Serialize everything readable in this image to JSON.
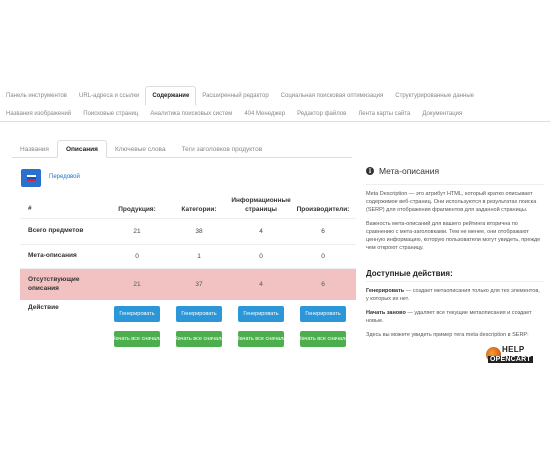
{
  "top_tabs": {
    "row1": [
      {
        "label": "Панель инструментов",
        "active": false
      },
      {
        "label": "URL-адреса и ссылки",
        "active": false
      },
      {
        "label": "Содержание",
        "active": true
      },
      {
        "label": "Расширенный редактор",
        "active": false
      },
      {
        "label": "Социальная поисковая оптимизация",
        "active": false
      },
      {
        "label": "Структурированные данные",
        "active": false
      }
    ],
    "row2": [
      {
        "label": "Названия изображений",
        "active": false
      },
      {
        "label": "Поисковые страниц",
        "active": false
      },
      {
        "label": "Аналитика поисковых систем",
        "active": false
      },
      {
        "label": "404 Менеджер",
        "active": false
      },
      {
        "label": "Редактор файлов",
        "active": false
      },
      {
        "label": "Лента карты сайта",
        "active": false
      },
      {
        "label": "Документация",
        "active": false
      }
    ]
  },
  "sub_tabs": [
    {
      "label": "Названия",
      "active": false
    },
    {
      "label": "Описания",
      "active": true
    },
    {
      "label": "Ключевые слова",
      "active": false
    },
    {
      "label": "Теги заголовков продуктов",
      "active": false
    }
  ],
  "advanced_link": "Передовой",
  "table": {
    "headers": [
      "#",
      "Продукция:",
      "Категории:",
      "Информационные страницы",
      "Производители:"
    ],
    "rows": [
      {
        "label": "Всего предметов",
        "values": [
          "21",
          "38",
          "4",
          "6"
        ]
      },
      {
        "label": "Мета-описания",
        "values": [
          "0",
          "1",
          "0",
          "0"
        ]
      },
      {
        "label": "Отсутствующие описания",
        "values": [
          "21",
          "37",
          "4",
          "6"
        ]
      }
    ],
    "action_label": "Действие",
    "generate_label": "Генерировать",
    "reset_label": "Начать все сначала"
  },
  "panel": {
    "title": "Мета-описания",
    "p1": "Meta Description — это атрибут HTML, который кратко описывает содержимое веб-страниц. Они используются в результатах поиска (SERP) для отображения фрагментов для заданной страницы.",
    "p2": "Важность мета-описаний для вашего рейтинга вторична по сравнению с мета-заголовками. Тем не менее, они отображают ценную информацию, которую пользователи могут увидеть, прежде чем откроют страницу.",
    "actions_title": "Доступные действия:",
    "gen_term": "Генерировать",
    "gen_desc": " — создает метаописания только для тех элементов, у которых их нет.",
    "reset_term": "Начать заново",
    "reset_desc": " — удаляет все текущие метаописания и создает новые.",
    "p3": "Здесь вы можете увидеть пример тега meta description в SERP:"
  },
  "logo": {
    "help": "HELP",
    "opencart": "OPENCART"
  },
  "colors": {
    "accent_blue": "#2b96d8",
    "green": "#4cae4c",
    "missing_row": "#f2c2c2",
    "flag_button": "#2b6fcf"
  }
}
